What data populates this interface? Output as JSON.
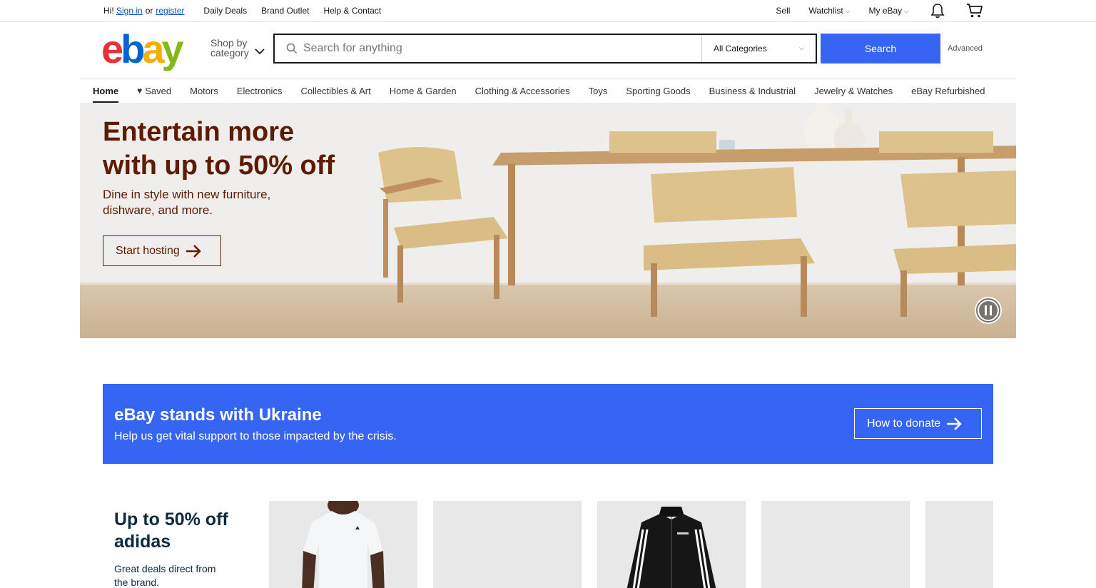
{
  "topbar": {
    "greeting": "Hi!",
    "sign_in": "Sign in",
    "or": "or",
    "register": "register",
    "links": [
      "Daily Deals",
      "Brand Outlet",
      "Help & Contact"
    ],
    "right": {
      "sell": "Sell",
      "watchlist": "Watchlist",
      "my_ebay": "My eBay"
    },
    "icons": [
      "notification-bell-icon",
      "cart-icon"
    ]
  },
  "header": {
    "logo_letters": [
      "e",
      "b",
      "a",
      "y"
    ],
    "logo_colors": [
      "#e53238",
      "#0064d2",
      "#f5af02",
      "#86b817"
    ],
    "shop_by_category": [
      "Shop by",
      "category"
    ],
    "search_placeholder": "Search for anything",
    "category_selected": "All Categories",
    "search_button": "Search",
    "advanced": "Advanced"
  },
  "nav": {
    "items": [
      "Home",
      "Saved",
      "Motors",
      "Electronics",
      "Collectibles & Art",
      "Home & Garden",
      "Clothing & Accessories",
      "Toys",
      "Sporting Goods",
      "Business & Industrial",
      "Jewelry & Watches",
      "eBay Refurbished"
    ],
    "active": "Home"
  },
  "hero": {
    "headline_line1": "Entertain more",
    "headline_line2": "with up to 50% off",
    "subtext_line1": "Dine in style with new furniture,",
    "subtext_line2": "dishware, and more.",
    "cta": "Start hosting",
    "text_color": "#5e1b00"
  },
  "ukraine_banner": {
    "title": "eBay stands with Ukraine",
    "message": "Help us get vital support to those impacted by the crisis.",
    "button": "How to donate",
    "background": "#3665f3"
  },
  "promo": {
    "title_line1": "Up to 50% off",
    "title_line2": "adidas",
    "subtitle_line1": "Great deals direct from",
    "subtitle_line2": "the brand."
  },
  "colors": {
    "accent": "#3665f3",
    "link": "#0654ba"
  }
}
